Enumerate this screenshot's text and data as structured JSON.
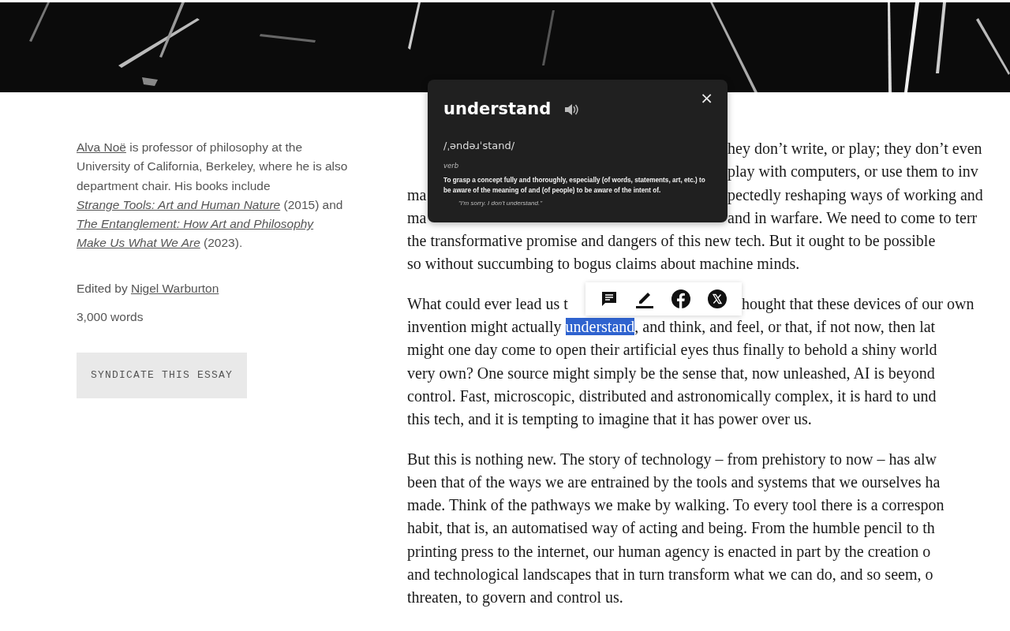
{
  "sidebar": {
    "bio": [
      {
        "kind": "link",
        "text": "Alva Noë"
      },
      {
        "kind": "plain",
        "text": " is professor of philosophy at the University of California, Berkeley, where he is also department chair. His books include "
      },
      {
        "kind": "book",
        "text": "Strange Tools: Art and Human Nature"
      },
      {
        "kind": "plain",
        "text": " (2015) and "
      },
      {
        "kind": "book",
        "text": "The Entanglement: How Art and Philosophy "
      },
      {
        "kind": "book",
        "text": "Make Us What We Are"
      },
      {
        "kind": "plain",
        "text": " (2023)."
      }
    ],
    "editor": {
      "label": "Edited by",
      "name": "Nigel Warburton"
    },
    "word_count": "3,000 words",
    "button": "SYNDICATE THIS ESSAY"
  },
  "article": {
    "paragraphs": [
      {
        "lines": [
          {
            "kind": "split",
            "right": "hey don’t write, or play; they don’t even"
          },
          {
            "kind": "split",
            "right": "play with computers, or use them to inv"
          },
          {
            "kind": "split",
            "left": "ma",
            "right": "pectedly reshaping ways of working and"
          },
          {
            "kind": "split",
            "left": "ma",
            "right": "and in warfare. We need to come to terr"
          },
          {
            "kind": "full",
            "text": "the transformative promise and dangers of this new tech. But it ought to be possible"
          },
          {
            "kind": "full",
            "text": "so without succumbing to bogus claims about machine minds."
          }
        ]
      },
      {
        "lines": [
          {
            "kind": "split",
            "left": "What could ever lead us t",
            "right": "hought that these devices of our own"
          },
          {
            "kind": "selection",
            "before": "invention might actually ",
            "selected": "understand",
            "after": ", and think, and feel, or that, if not now, then lat"
          },
          {
            "kind": "full",
            "text": "might one day come to open their artificial eyes thus finally to behold a shiny world"
          },
          {
            "kind": "full",
            "text": "very own? One source might simply be the sense that, now unleashed, AI is beyond"
          },
          {
            "kind": "full",
            "text": "control. Fast, microscopic, distributed and astronomically complex, it is hard to und"
          },
          {
            "kind": "full",
            "text": "this tech, and it is tempting to imagine that it has power over us."
          }
        ]
      },
      {
        "lines": [
          {
            "kind": "full",
            "text": "But this is nothing new. The story of technology – from prehistory to now – has alw"
          },
          {
            "kind": "full",
            "text": "been that of the ways we are entrained by the tools and systems that we ourselves ha"
          },
          {
            "kind": "full",
            "text": "made. Think of the pathways we make by walking. To every tool there is a correspon"
          },
          {
            "kind": "full",
            "text": "habit, that is, an automatised way of acting and being. From the humble pencil to th"
          },
          {
            "kind": "full",
            "text": "printing press to the internet, our human agency is enacted in part by the creation o"
          },
          {
            "kind": "full",
            "text": "and technological landscapes that in turn transform what we can do, and so seem, o"
          },
          {
            "kind": "full",
            "text": "threaten, to govern and control us."
          }
        ]
      }
    ]
  },
  "dictionary_popup": {
    "word": "understand",
    "close": "×",
    "pronunciation": "/ˌəndəɹˈstand/",
    "part_of_speech": "verb",
    "definition": "To grasp a concept fully and thoroughly, especially (of words, statements, art, etc.) to be aware of the meaning of and (of people) to be aware of the intent of.",
    "example": "\"I'm sorry. I don't understand.\""
  },
  "selection_toolbar": {
    "buttons": [
      {
        "kind": "comment"
      },
      {
        "kind": "highlight"
      },
      {
        "kind": "facebook"
      },
      {
        "kind": "x"
      }
    ]
  }
}
